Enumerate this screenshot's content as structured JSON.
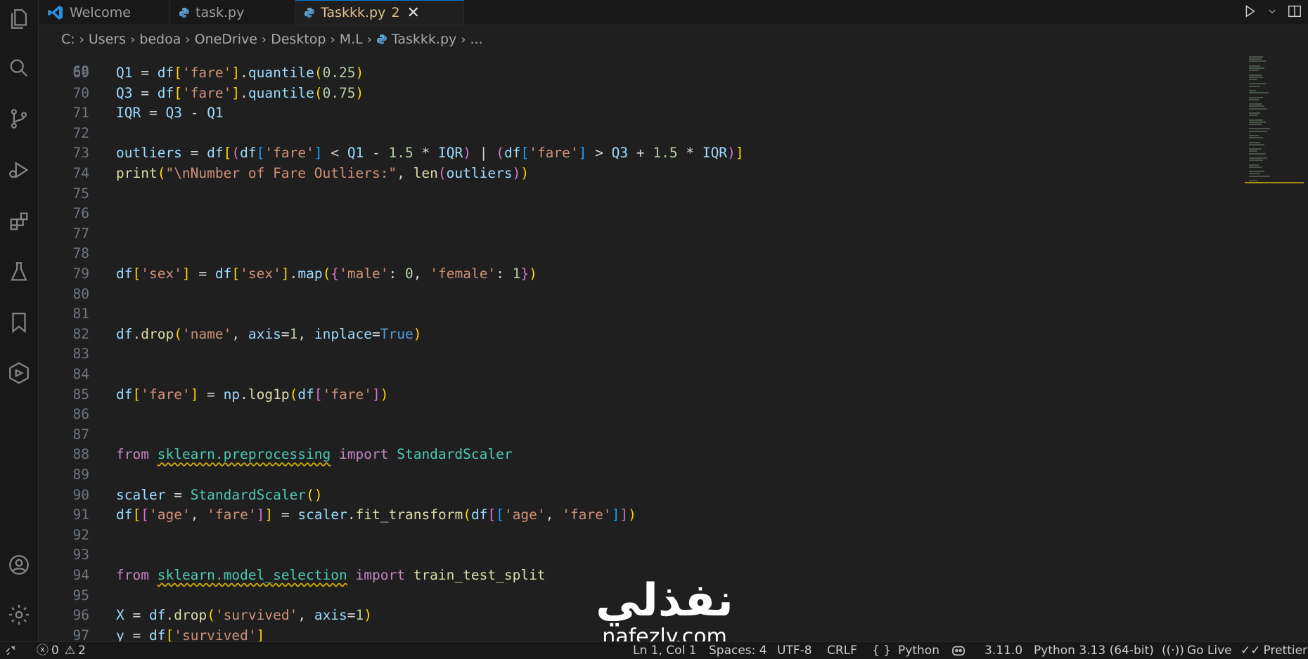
{
  "tabs": [
    {
      "label": "Welcome",
      "icon": "vscode-icon",
      "active": false
    },
    {
      "label": "task.py",
      "icon": "python-icon",
      "active": false
    },
    {
      "label": "Taskkk.py",
      "icon": "python-icon",
      "active": true,
      "badge": "2",
      "close": "✕"
    }
  ],
  "breadcrumb": [
    "C:",
    "Users",
    "bedoa",
    "OneDrive",
    "Desktop",
    "M.L",
    "Taskkk.py",
    "..."
  ],
  "editor": {
    "partial_line_number": "68",
    "lines": [
      {
        "n": "69",
        "text": "Q1 = df['fare'].quantile(0.25)"
      },
      {
        "n": "70",
        "text": "Q3 = df['fare'].quantile(0.75)"
      },
      {
        "n": "71",
        "text": "IQR = Q3 - Q1"
      },
      {
        "n": "72",
        "text": ""
      },
      {
        "n": "73",
        "text": "outliers = df[(df['fare'] < Q1 - 1.5 * IQR) | (df['fare'] > Q3 + 1.5 * IQR)]"
      },
      {
        "n": "74",
        "text": "print(\"\\nNumber of Fare Outliers:\", len(outliers))"
      },
      {
        "n": "75",
        "text": ""
      },
      {
        "n": "76",
        "text": ""
      },
      {
        "n": "77",
        "text": ""
      },
      {
        "n": "78",
        "text": ""
      },
      {
        "n": "79",
        "text": "df['sex'] = df['sex'].map({'male': 0, 'female': 1})"
      },
      {
        "n": "80",
        "text": ""
      },
      {
        "n": "81",
        "text": ""
      },
      {
        "n": "82",
        "text": "df.drop('name', axis=1, inplace=True)"
      },
      {
        "n": "83",
        "text": ""
      },
      {
        "n": "84",
        "text": ""
      },
      {
        "n": "85",
        "text": "df['fare'] = np.log1p(df['fare'])"
      },
      {
        "n": "86",
        "text": ""
      },
      {
        "n": "87",
        "text": ""
      },
      {
        "n": "88",
        "text": "from sklearn.preprocessing import StandardScaler"
      },
      {
        "n": "89",
        "text": ""
      },
      {
        "n": "90",
        "text": "scaler = StandardScaler()"
      },
      {
        "n": "91",
        "text": "df[['age', 'fare']] = scaler.fit_transform(df[['age', 'fare']])"
      },
      {
        "n": "92",
        "text": ""
      },
      {
        "n": "93",
        "text": ""
      },
      {
        "n": "94",
        "text": "from sklearn.model_selection import train_test_split"
      },
      {
        "n": "95",
        "text": ""
      },
      {
        "n": "96",
        "text": "X = df.drop('survived', axis=1)"
      },
      {
        "n": "97",
        "text": "y = df['survived']"
      }
    ]
  },
  "status": {
    "errors": "0",
    "warnings": "2",
    "cursor": "Ln 1, Col 1",
    "spaces": "Spaces: 4",
    "encoding": "UTF-8",
    "eol": "CRLF",
    "language_braces": "{ }",
    "language": "Python",
    "version": "3.11.0",
    "interpreter": "Python 3.13 (64-bit)",
    "go_live": "Go Live",
    "prettier": "Prettier"
  },
  "watermark": {
    "arabic": "نفذلي",
    "latin": "nafezly.com"
  },
  "colors": {
    "accent": "#0078d4",
    "modified_tab": "#e2c08d"
  }
}
